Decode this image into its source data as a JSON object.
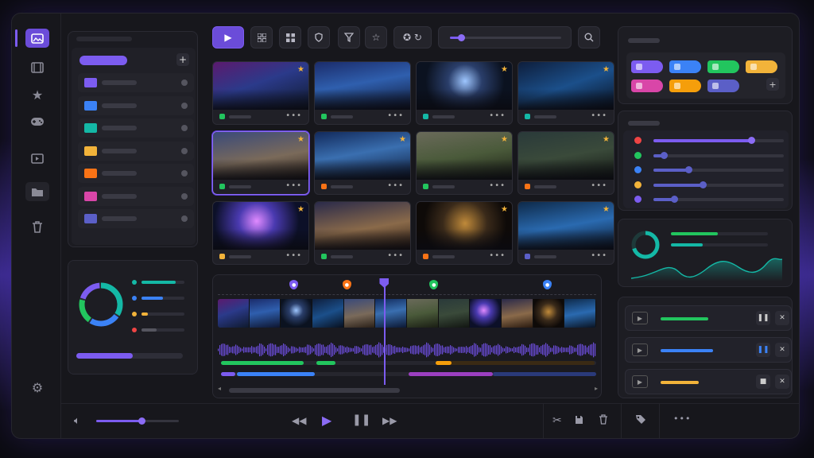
{
  "colors": {
    "accent": "#7c5cf0",
    "star": "#f2b33a",
    "green": "#22c55e",
    "blue": "#3b82f6",
    "orange": "#f59e0b",
    "pink": "#d946a8",
    "red": "#ef4444",
    "teal": "#14b8a6"
  },
  "rail": {
    "items": [
      "images-icon",
      "film-icon",
      "star-icon",
      "gamepad-icon",
      "play-box-icon",
      "folder-icon",
      "trash-icon"
    ],
    "settings": "gear-icon"
  },
  "folders": {
    "add_label": "+",
    "items": [
      {
        "color": "#7c5cf0"
      },
      {
        "color": "#3b82f6"
      },
      {
        "color": "#14b8a6"
      },
      {
        "color": "#f2b33a"
      },
      {
        "color": "#f97316"
      },
      {
        "color": "#d946a8"
      },
      {
        "color": "#5b5fc7"
      }
    ]
  },
  "storage": {
    "ring": [
      {
        "color": "#14b8a6",
        "share": 0.35
      },
      {
        "color": "#3b82f6",
        "share": 0.25
      },
      {
        "color": "#22c55e",
        "share": 0.2
      },
      {
        "color": "#7c5cf0",
        "share": 0.2
      }
    ],
    "legend": [
      {
        "color": "#14b8a6",
        "level": 0.8
      },
      {
        "color": "#3b82f6",
        "level": 0.5
      },
      {
        "color": "#f2b33a",
        "level": 0.15
      },
      {
        "color": "#ef4444",
        "level": 0.35
      }
    ],
    "usage": 0.53
  },
  "toolbar": {
    "icons": [
      "play-icon",
      "grid-icon",
      "grid-alt-icon",
      "shield-icon",
      "filter-icon",
      "star-outline-icon",
      "favorites-icon"
    ],
    "zoom": 0.1,
    "search": "search-icon"
  },
  "gallery": [
    {
      "tag": "#22c55e",
      "star": true,
      "bg": "linear-gradient(160deg,#5b1a6e,#2b3a8a 45%,#0f1a2e)",
      "sel": false
    },
    {
      "tag": "#22c55e",
      "star": false,
      "bg": "linear-gradient(170deg,#1b2c6b,#2f5fae 45%,#0e1630)",
      "sel": false
    },
    {
      "tag": "#14b8a6",
      "star": true,
      "bg": "radial-gradient(circle at 50% 40%,#9ec6ff,#2a3e6a 30%,#0b1220 70%)",
      "sel": false
    },
    {
      "tag": "#14b8a6",
      "star": true,
      "bg": "linear-gradient(160deg,#0e1e3c,#1b4f8a 50%,#08101e)",
      "sel": false
    },
    {
      "tag": "#22c55e",
      "star": true,
      "bg": "linear-gradient(170deg,#3a4a7a,#7a6a5a 55%,#2a2018)",
      "sel": true
    },
    {
      "tag": "#f97316",
      "star": true,
      "bg": "linear-gradient(170deg,#122a5c,#3a6fb0 45%,#0c1834)",
      "sel": false
    },
    {
      "tag": "#22c55e",
      "star": true,
      "bg": "linear-gradient(170deg,#6a6a5a,#4a5a3a 50%,#1a1e14)",
      "sel": false
    },
    {
      "tag": "#f97316",
      "star": true,
      "bg": "linear-gradient(170deg,#2a3a3a,#3a4a3a 50%,#121612)",
      "sel": false
    },
    {
      "tag": "#f2b33a",
      "star": true,
      "bg": "radial-gradient(circle at 45% 40%,#e08aff,#4a3ab0 30%,#0c1028 70%)",
      "sel": false
    },
    {
      "tag": "#22c55e",
      "star": false,
      "bg": "linear-gradient(170deg,#2a2a4a,#8a6a4a 55%,#2a1a10)",
      "sel": false
    },
    {
      "tag": "#f97316",
      "star": true,
      "bg": "radial-gradient(circle at 50% 45%,#c08a3a,#3a2a1a 40%,#0e0a08 75%)",
      "sel": false
    },
    {
      "tag": "#5b5fc7",
      "star": true,
      "bg": "linear-gradient(170deg,#0e2a4a,#2a6ab0 50%,#0a1424)",
      "sel": false
    }
  ],
  "timeline": {
    "markers": [
      {
        "color": "#7c5cf0",
        "pos": 0.2
      },
      {
        "color": "#f97316",
        "pos": 0.34
      },
      {
        "color": "#22c55e",
        "pos": 0.57
      },
      {
        "color": "#3b82f6",
        "pos": 0.87
      }
    ],
    "playhead": 0.44,
    "scroll": 0.45
  },
  "tags": {
    "chips": [
      {
        "color": "#7c5cf0"
      },
      {
        "color": "#3b82f6"
      },
      {
        "color": "#22c55e"
      },
      {
        "color": "#f2b33a"
      },
      {
        "color": "#d946a8"
      },
      {
        "color": "#f59e0b"
      },
      {
        "color": "#5b5fc7"
      }
    ],
    "add_label": "+"
  },
  "adjust": {
    "rows": [
      {
        "color": "#ef4444",
        "level": 0.75,
        "tint": "#7c5cf0"
      },
      {
        "color": "#22c55e",
        "level": 0.08,
        "tint": "#5b5fc7"
      },
      {
        "color": "#3b82f6",
        "level": 0.27,
        "tint": "#5b5fc7"
      },
      {
        "color": "#f2b33a",
        "level": 0.38,
        "tint": "#5b5fc7"
      },
      {
        "color": "#7c5cf0",
        "level": 0.16,
        "tint": "#5b5fc7"
      }
    ]
  },
  "stats": {
    "ring": 0.7,
    "bars": [
      {
        "color": "#22c55e",
        "level": 0.48
      },
      {
        "color": "#14b8a6",
        "level": 0.33
      }
    ]
  },
  "exports": [
    {
      "color": "#22c55e",
      "level": 0.5,
      "action": "pause-icon"
    },
    {
      "color": "#3b82f6",
      "level": 0.55,
      "action": "pause-icon"
    },
    {
      "color": "#f2b33a",
      "level": 0.4,
      "action": "stop-icon"
    }
  ],
  "playback": {
    "volume": 0.55,
    "controls": [
      "rewind-icon",
      "play-icon",
      "pause-icon",
      "forward-icon"
    ],
    "edit": [
      "cut-icon",
      "save-icon",
      "delete-icon",
      "tag-icon",
      "more-icon"
    ],
    "more_label": "•••"
  }
}
